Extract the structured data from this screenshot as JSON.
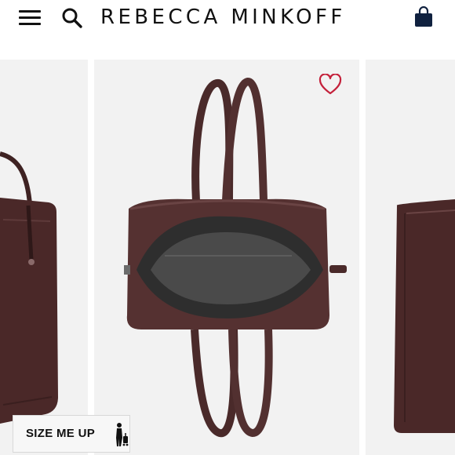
{
  "header": {
    "brand": "REBECCA MINKOFF",
    "menu_icon": "hamburger-menu-icon",
    "search_icon": "search-icon",
    "bag_icon": "shopping-bag-icon"
  },
  "carousel": {
    "favorite_icon": "heart-outline-icon",
    "favorite_color": "#c4213b",
    "product_color": "#4a2a2a",
    "slides": [
      {
        "position": "previous",
        "description": "burgundy leather tote partial"
      },
      {
        "position": "current",
        "description": "burgundy leather duffel top view"
      },
      {
        "position": "next",
        "description": "burgundy leather bag partial"
      }
    ]
  },
  "size_button": {
    "label": "SIZE ME UP",
    "icon": "person-with-luggage-icon"
  }
}
